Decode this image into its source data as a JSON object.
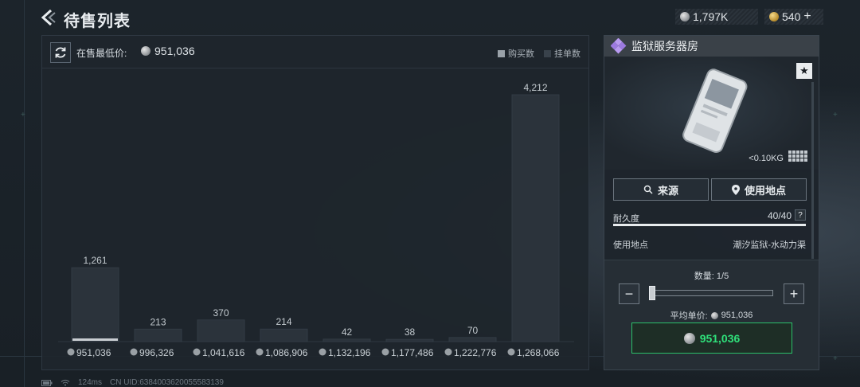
{
  "header": {
    "title": "待售列表",
    "currency_silver": "1,797K",
    "currency_gold": "540",
    "currency_gold_add": "+"
  },
  "listing": {
    "lowest_price_label": "在售最低价:",
    "lowest_price_value": "951,036",
    "legend_buy": "购买数",
    "legend_list": "挂单数"
  },
  "chart_data": {
    "type": "bar",
    "categories": [
      "951,036",
      "996,326",
      "1,041,616",
      "1,086,906",
      "1,132,196",
      "1,177,486",
      "1,222,776",
      "1,268,066"
    ],
    "series": [
      {
        "name": "挂单数",
        "values": [
          1261,
          213,
          370,
          214,
          42,
          38,
          70,
          4212
        ]
      },
      {
        "name": "购买数",
        "values": [
          60,
          0,
          0,
          0,
          0,
          0,
          0,
          0
        ]
      }
    ],
    "value_labels": [
      "1,261",
      "213",
      "370",
      "214",
      "42",
      "38",
      "70",
      "4,212"
    ],
    "ylim": [
      0,
      4212
    ],
    "colors": {
      "list": "#2b333b",
      "buy": "#c9ced2"
    }
  },
  "item": {
    "name": "监狱服务器房",
    "favorite_glyph": "★",
    "weight": "<0.10KG",
    "source_btn": "来源",
    "use_location_btn": "使用地点",
    "durability_label": "耐久度",
    "durability_value": "40/40",
    "durability_fraction": 1.0,
    "help_glyph": "?",
    "use_location_label": "使用地点",
    "use_location_value": "潮汐监狱-水动力渠"
  },
  "purchase": {
    "quantity_label": "数量: 1/5",
    "minus": "−",
    "plus": "+",
    "avg_price_label": "平均单价:",
    "avg_price_value": "951,036",
    "buy_total": "951,036",
    "accent_color": "#2fe07a"
  },
  "footer": {
    "ping": "124ms",
    "uid": "CN UID:6384003620055583139"
  }
}
